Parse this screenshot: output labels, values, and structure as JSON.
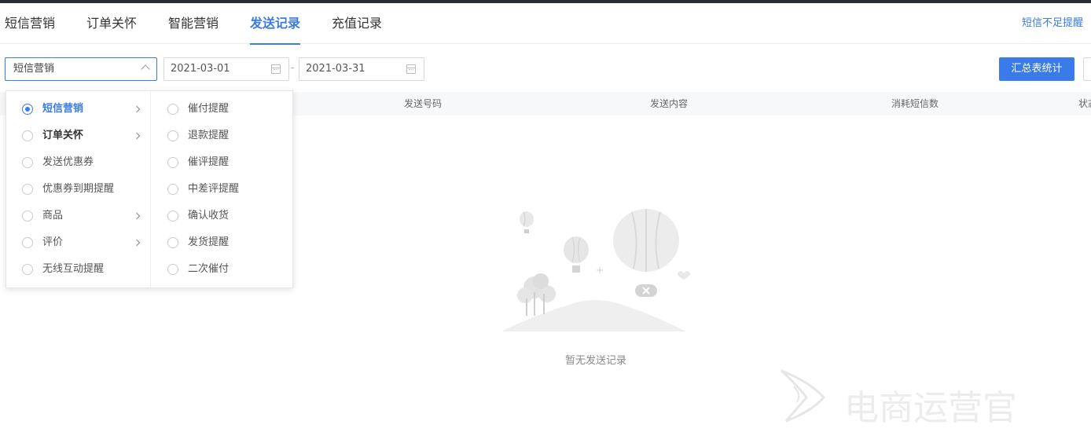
{
  "tabs": [
    {
      "label": "短信营销",
      "active": false
    },
    {
      "label": "订单关怀",
      "active": false
    },
    {
      "label": "智能营销",
      "active": false
    },
    {
      "label": "发送记录",
      "active": true
    },
    {
      "label": "充值记录",
      "active": false
    }
  ],
  "tab_link": "短信不足提醒",
  "filter": {
    "category_value": "短信营销",
    "date_start": "2021-03-01",
    "date_end": "2021-03-31",
    "date_separator": "-",
    "summary_button": "汇总表统计"
  },
  "table": {
    "columns": [
      "发送号码",
      "发送内容",
      "消耗短信数",
      "状态"
    ]
  },
  "cascade": {
    "level1": [
      {
        "label": "短信营销",
        "checked": true,
        "has_children": true
      },
      {
        "label": "订单关怀",
        "checked": false,
        "has_children": true
      },
      {
        "label": "发送优惠券",
        "checked": false,
        "has_children": false
      },
      {
        "label": "优惠券到期提醒",
        "checked": false,
        "has_children": false
      },
      {
        "label": "商品",
        "checked": false,
        "has_children": true
      },
      {
        "label": "评价",
        "checked": false,
        "has_children": true
      },
      {
        "label": "无线互动提醒",
        "checked": false,
        "has_children": false
      }
    ],
    "level2": [
      {
        "label": "催付提醒"
      },
      {
        "label": "退款提醒"
      },
      {
        "label": "催评提醒"
      },
      {
        "label": "中差评提醒"
      },
      {
        "label": "确认收货"
      },
      {
        "label": "发货提醒"
      },
      {
        "label": "二次催付"
      }
    ]
  },
  "empty": {
    "text": "暂无发送记录"
  },
  "watermark": {
    "line1": "电商运营官"
  },
  "colors": {
    "accent": "#3a7bea",
    "topbar": "#2a2c33"
  }
}
